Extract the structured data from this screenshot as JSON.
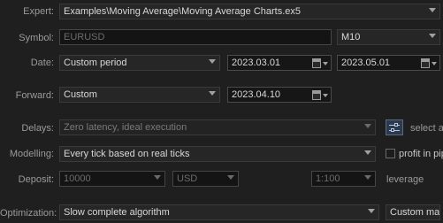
{
  "expert": {
    "label": "Expert:",
    "value": "Examples\\Moving Average\\Moving Average Charts.ex5"
  },
  "symbol": {
    "label": "Symbol:",
    "value": "EURUSD",
    "timeframe": "M10"
  },
  "date": {
    "label": "Date:",
    "mode": "Custom period",
    "from": "2023.03.01",
    "to": "2023.05.01"
  },
  "forward": {
    "label": "Forward:",
    "mode": "Custom",
    "date": "2023.04.10"
  },
  "delays": {
    "label": "Delays:",
    "value": "Zero latency, ideal execution",
    "side_text": "select a"
  },
  "modelling": {
    "label": "Modelling:",
    "value": "Every tick based on real ticks",
    "checkbox_label": "profit in pip"
  },
  "deposit": {
    "label": "Deposit:",
    "amount": "10000",
    "currency": "USD",
    "leverage": "1:100",
    "leverage_label": "leverage"
  },
  "optimization": {
    "label": "Optimization:",
    "value": "Slow complete algorithm",
    "criterion": "Custom max"
  }
}
